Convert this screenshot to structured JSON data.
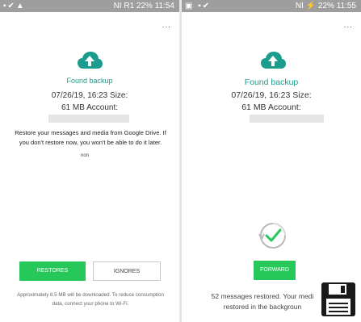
{
  "left": {
    "status": {
      "icons": "▪✔▲",
      "right": "NI R1 22% 11:54"
    },
    "menu": "...",
    "found_backup": "Found backup",
    "date_size": "07/26/19, 16:23 Size:",
    "mb_account": "61 MB Account:",
    "restore_message": "Restore your messages and media from Google Drive. If you don't restore now, you won't be able to do it later.",
    "overlay_text": "non",
    "restore_button": "RESTORES",
    "ignore_button": "IGNORES",
    "download_note": "Approximately 8.5 MB will be downloaded. To reduce consumption data, connect your phone to Wi-Fi."
  },
  "right": {
    "status": {
      "icons": "▣ ▪✔",
      "right": "NI ⚡ 22% 11:55"
    },
    "menu": "...",
    "found_backup": "Found backup",
    "date_size": "07/26/19, 16:23 Size:",
    "mb_account": "61 MB Account:",
    "forward_button": "FORWARD",
    "restored_line1": "52 messages restored. Your medi",
    "restored_line2": "restored in the backgroun"
  },
  "colors": {
    "accent": "#1c9c8c",
    "button_green": "#27c85a",
    "statusbar": "#9e9e9e"
  },
  "icons": [
    "cloud-upload-icon",
    "check-circle-icon",
    "floppy-disk-icon",
    "overflow-menu-icon"
  ]
}
